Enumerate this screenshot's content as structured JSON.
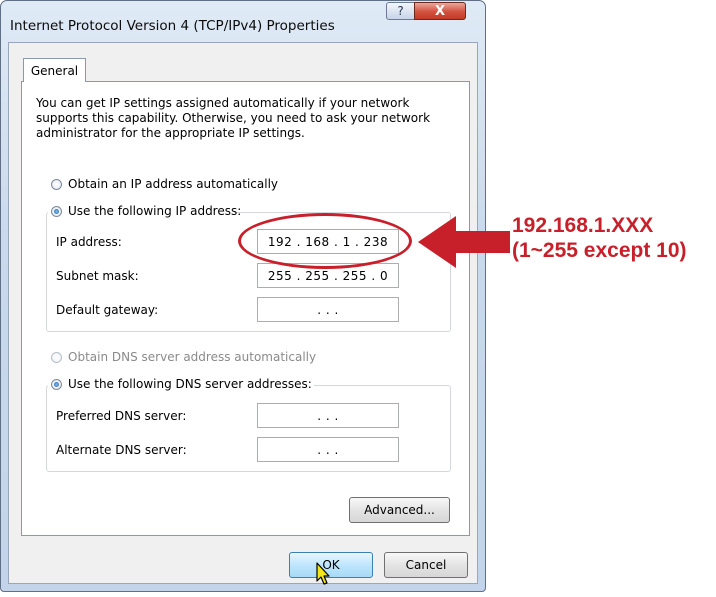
{
  "window": {
    "title": "Internet Protocol Version 4 (TCP/IPv4) Properties",
    "help_label": "?",
    "close_label": "X"
  },
  "tabs": [
    {
      "label": "General",
      "active": true
    }
  ],
  "description": "You can get IP settings assigned automatically if your network supports this capability. Otherwise, you need to ask your network administrator for the appropriate IP settings.",
  "ip_mode": {
    "auto_label": "Obtain an IP address automatically",
    "manual_label": "Use the following IP address:",
    "selected": "manual"
  },
  "ip_fields": [
    {
      "label": "IP address:",
      "value": "192 .  168 .   1   .  238"
    },
    {
      "label": "Subnet mask:",
      "value": "255 .  255 .  255 .   0"
    },
    {
      "label": "Default gateway:",
      "value": ".          .          ."
    }
  ],
  "dns_mode": {
    "auto_label": "Obtain DNS server address automatically",
    "manual_label": "Use the following DNS server addresses:",
    "selected": "manual",
    "auto_disabled": true
  },
  "dns_fields": [
    {
      "label": "Preferred DNS server:",
      "value": ".          .          ."
    },
    {
      "label": "Alternate DNS server:",
      "value": ".          .          ."
    }
  ],
  "buttons": {
    "advanced": "Advanced...",
    "ok": "OK",
    "cancel": "Cancel"
  },
  "annotation": {
    "line1": "192.168.1.XXX",
    "line2": "(1~255 except 10)",
    "color": "#c8202a"
  }
}
